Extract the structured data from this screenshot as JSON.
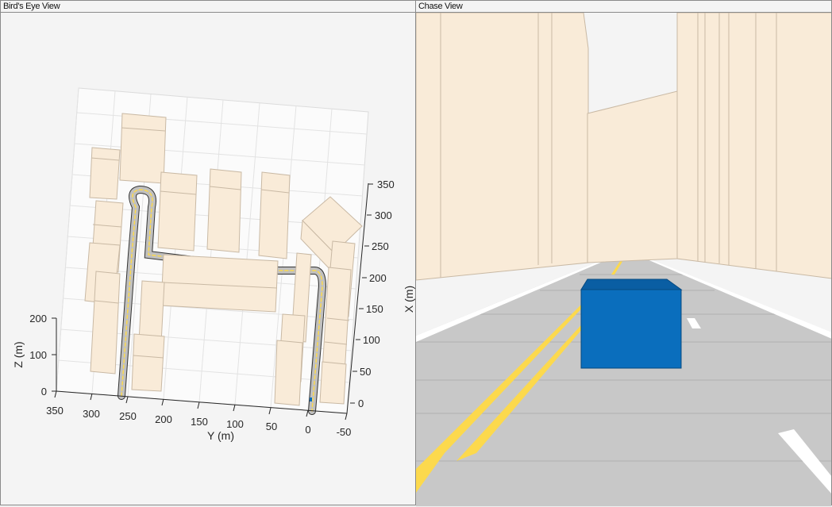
{
  "panels": {
    "birds_eye": {
      "title": "Bird's Eye View",
      "y_axis_label": "Y (m)",
      "x_axis_label": "X (m)",
      "z_axis_label": "Z (m)",
      "y_ticks": [
        "350",
        "300",
        "250",
        "200",
        "150",
        "100",
        "50",
        "0",
        "-50"
      ],
      "x_ticks": [
        "0",
        "50",
        "100",
        "150",
        "200",
        "250",
        "300",
        "350"
      ],
      "z_ticks": [
        "0",
        "100",
        "200"
      ]
    },
    "chase": {
      "title": "Chase View"
    }
  },
  "colors": {
    "building": "#f9ebd8",
    "road": "#c8c8c8",
    "lane_marking": "#fcd94d",
    "ego_vehicle": "#0a6ebd"
  }
}
